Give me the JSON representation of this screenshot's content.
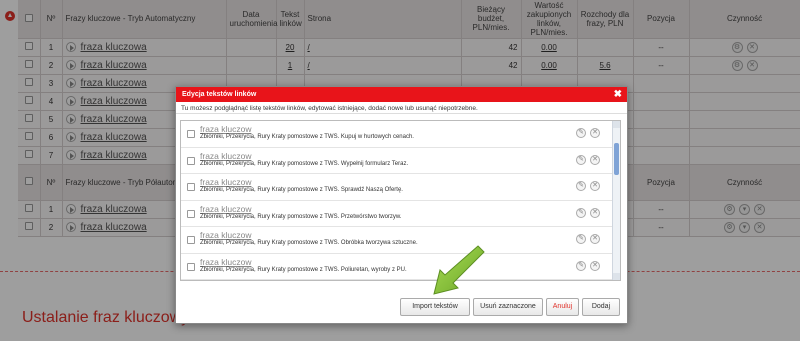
{
  "table_auto": {
    "headers": {
      "no": "Nº",
      "keyword": "Frazy kluczowe - Tryb Automatyczny",
      "start_date": "Data uruchomienia",
      "link_text": "Tekst linków",
      "page": "Strona",
      "budget": "Bieżący budżet, PLN/mies.",
      "purchased_links": "Wartość zakupionych linków, PLN/mies.",
      "expenses": "Rozchody dla frazy, PLN",
      "position": "Pozycja",
      "action": "Czynność"
    },
    "rows": [
      {
        "no": "1",
        "keyword": "fraza kluczowa",
        "links": "20",
        "page": "/",
        "budget": "42",
        "purchased": "0.00",
        "expenses": "",
        "position": "--"
      },
      {
        "no": "2",
        "keyword": "fraza kluczowa",
        "links": "1",
        "page": "/",
        "budget": "42",
        "purchased": "0.00",
        "expenses": "5.6",
        "position": "--"
      },
      {
        "no": "3",
        "keyword": "fraza kluczowa",
        "links": "",
        "page": "",
        "budget": "",
        "purchased": "",
        "expenses": "",
        "position": ""
      },
      {
        "no": "4",
        "keyword": "fraza kluczowa",
        "links": "",
        "page": "",
        "budget": "",
        "purchased": "",
        "expenses": "",
        "position": ""
      },
      {
        "no": "5",
        "keyword": "fraza kluczowa",
        "links": "",
        "page": "",
        "budget": "",
        "purchased": "",
        "expenses": "",
        "position": ""
      },
      {
        "no": "6",
        "keyword": "fraza kluczowa",
        "links": "",
        "page": "",
        "budget": "",
        "purchased": "",
        "expenses": "",
        "position": ""
      },
      {
        "no": "7",
        "keyword": "fraza kluczowa",
        "links": "",
        "page": "",
        "budget": "",
        "purchased": "",
        "expenses": "",
        "position": ""
      }
    ]
  },
  "table_semi": {
    "headers": {
      "no": "Nº",
      "keyword": "Frazy kluczowe - Tryb Półautomatyczny",
      "position": "Pozycja",
      "action": "Czynność"
    },
    "rows": [
      {
        "no": "1",
        "keyword": "fraza kluczowa",
        "position": "--"
      },
      {
        "no": "2",
        "keyword": "fraza kluczowa",
        "position": "--"
      }
    ]
  },
  "section_title": "Ustalanie fraz kluczowych",
  "modal": {
    "title": "Edycja tekstów linków",
    "description": "Tu możesz podglądnąć listę tekstów linków, edytować istniejące, dodać nowe lub usunąć niepotrzebne.",
    "items": [
      {
        "title": "fraza kluczow",
        "text": "Zbiorniki, Przekrycia, Rury Kraty pomostowe z TWS. Kupuj w hurtowych cenach."
      },
      {
        "title": "fraza kluczow",
        "text": "Zbiorniki, Przekrycia, Rury Kraty pomostowe z TWS. Wypełnij formularz Teraz."
      },
      {
        "title": "fraza kluczow",
        "text": "Zbiorniki, Przekrycia, Rury Kraty pomostowe z TWS. Sprawdź Naszą Ofertę."
      },
      {
        "title": "fraza kluczow",
        "text": "Zbiorniki, Przekrycia, Rury Kraty pomostowe z TWS. Przetwórstwo tworzyw."
      },
      {
        "title": "fraza kluczow",
        "text": "Zbiorniki, Przekrycia, Rury Kraty pomostowe z TWS. Obróbka tworzywa sztuczne."
      },
      {
        "title": "fraza kluczow",
        "text": "Zbiorniki, Przekrycia, Rury Kraty pomostowe z TWS. Poliuretan, wyroby z PU."
      }
    ],
    "buttons": {
      "import": "Import tekstów",
      "delete_selected": "Usuń zaznaczone",
      "cancel": "Anuluj",
      "add": "Dodaj"
    }
  },
  "colors": {
    "accent": "#e8141a",
    "arrow": "#8cc43a"
  }
}
